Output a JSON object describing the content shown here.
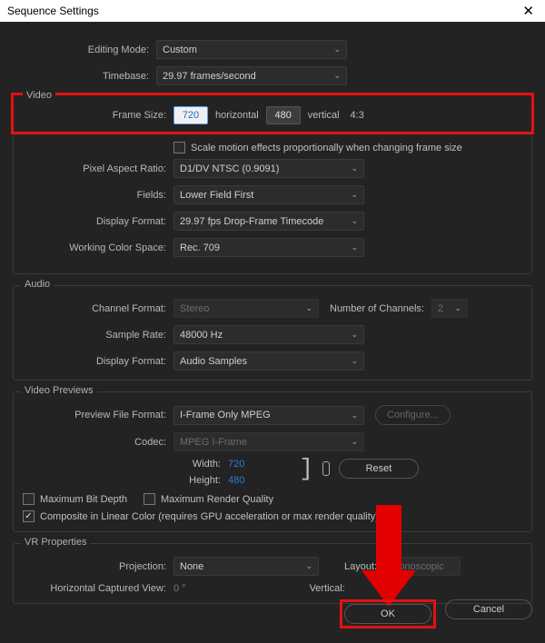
{
  "window": {
    "title": "Sequence Settings"
  },
  "editing_mode": {
    "label": "Editing Mode:",
    "value": "Custom"
  },
  "timebase": {
    "label": "Timebase:",
    "value": "29.97  frames/second"
  },
  "video": {
    "legend": "Video",
    "frame_size_label": "Frame Size:",
    "width": "720",
    "horizontal": "horizontal",
    "height": "480",
    "vertical": "vertical",
    "aspect": "4:3",
    "scale_effects": "Scale motion effects proportionally when changing frame size",
    "par_label": "Pixel Aspect Ratio:",
    "par_value": "D1/DV NTSC (0.9091)",
    "fields_label": "Fields:",
    "fields_value": "Lower Field First",
    "dispfmt_label": "Display Format:",
    "dispfmt_value": "29.97 fps Drop-Frame Timecode",
    "wcs_label": "Working Color Space:",
    "wcs_value": "Rec. 709"
  },
  "audio": {
    "legend": "Audio",
    "chfmt_label": "Channel Format:",
    "chfmt_value": "Stereo",
    "numch_label": "Number of Channels:",
    "numch_value": "2",
    "srate_label": "Sample Rate:",
    "srate_value": "48000 Hz",
    "dispfmt_label": "Display Format:",
    "dispfmt_value": "Audio Samples"
  },
  "previews": {
    "legend": "Video Previews",
    "pff_label": "Preview File Format:",
    "pff_value": "I-Frame Only MPEG",
    "configure": "Configure...",
    "codec_label": "Codec:",
    "codec_value": "MPEG I-Frame",
    "width_label": "Width:",
    "width_value": "720",
    "height_label": "Height:",
    "height_value": "480",
    "reset": "Reset",
    "max_bit_depth": "Maximum Bit Depth",
    "max_render_q": "Maximum Render Quality",
    "composite_linear": "Composite in Linear Color (requires GPU acceleration or max render quality)"
  },
  "vr": {
    "legend": "VR Properties",
    "proj_label": "Projection:",
    "proj_value": "None",
    "layout_label": "Layout:",
    "layout_value": "Monoscopic",
    "hcv_label": "Horizontal Captured View:",
    "hcv_value": "0 °",
    "vert_label": "Vertical:"
  },
  "footer": {
    "ok": "OK",
    "cancel": "Cancel"
  }
}
